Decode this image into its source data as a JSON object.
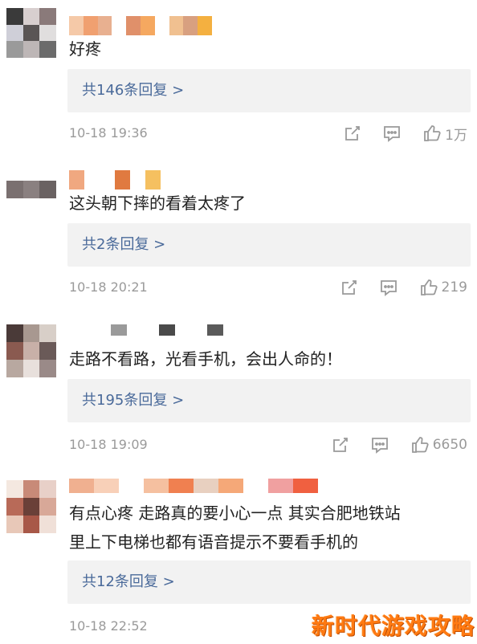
{
  "comments": [
    {
      "text_lines": [
        "好疼"
      ],
      "reply": "共146条回复 >",
      "time": "10-18 19:36",
      "likes": "1万",
      "avatar_colors": [
        "#3a3a3a",
        "#d8cfcf",
        "#8a7a7a",
        "#cfcfd8",
        "#5a5555",
        "#e0dede",
        "#9a9a9a",
        "#bdb6b6",
        "#6b6b6b"
      ],
      "name_colors": [
        "#f5c9a8",
        "#f0a070",
        "#e8b090",
        "#ffffff",
        "#e0906a",
        "#f5a860",
        "#ffffff",
        "#f0c090",
        "#d8a080",
        "#f4b040"
      ]
    },
    {
      "text_lines": [
        "这头朝下摔的看着太疼了"
      ],
      "reply": "共2条回复 >",
      "time": "10-18 20:21",
      "likes": "219",
      "avatar_colors": [
        "#ffffff",
        "#ffffff",
        "#ffffff",
        "#7a7070",
        "#8a8080",
        "#6a6262",
        "#ffffff",
        "#ffffff",
        "#ffffff"
      ],
      "name_colors": [
        "#f0a880",
        "#ffffff",
        "#ffffff",
        "#e07a40",
        "#ffffff",
        "#f5c060"
      ]
    },
    {
      "text_lines": [
        "走路不看路，光看手机，会出人命的！"
      ],
      "reply": "共195条回复 >",
      "time": "10-18 19:09",
      "likes": "6650",
      "avatar_colors": [
        "#4a3a38",
        "#a89890",
        "#d8cfc8",
        "#8a5a50",
        "#c8b0a8",
        "#6a5a58",
        "#b8a8a0",
        "#e8e0dc",
        "#9a8a88"
      ],
      "name_colors": [
        "#ffffff",
        "#9a9a9a",
        "#ffffff",
        "#ffffff",
        "#4a4a4a",
        "#ffffff",
        "#ffffff",
        "#5a5a5a"
      ]
    },
    {
      "text_lines": [
        "有点心疼  走路真的要小心一点  其实合肥地铁站",
        "里上下电梯也都有语音提示不要看手机的"
      ],
      "reply": "共12条回复 >",
      "time": "10-18 22:52",
      "likes": "",
      "avatar_colors": [
        "#f4e8e0",
        "#c88a78",
        "#e8d0c8",
        "#b86a58",
        "#6a4038",
        "#d8a898",
        "#e8c8b8",
        "#a85848",
        "#f0e0d8"
      ],
      "name_colors": [
        "#f0b090",
        "#f8d0b8",
        "#ffffff",
        "#f5c0a0",
        "#f08050",
        "#e8d0c0",
        "#f5a878",
        "#ffffff",
        "#f0a0a0",
        "#f06040"
      ]
    }
  ],
  "watermark": "新时代游戏攻略",
  "colors": {
    "link": "#4a6a9a",
    "meta": "#9a9a9a",
    "reply_bg": "#f2f2f2"
  },
  "icons": [
    "share-icon",
    "comment-icon",
    "like-icon"
  ]
}
